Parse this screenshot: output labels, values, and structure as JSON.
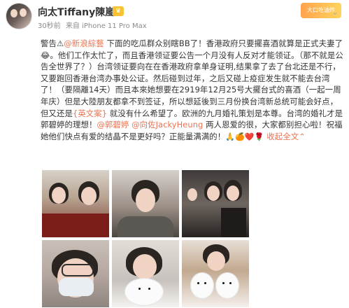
{
  "header": {
    "username": "向太Tiffany陳嵐",
    "vip_badge": "♛",
    "time": "30秒前",
    "device": "来自 iPhone 11 Pro Max",
    "chevron": "⌄",
    "top_right_badge": "大口吃油炸"
  },
  "post": {
    "p1": "警告⚠",
    "mention1": "@新浪綜藝",
    "p2": " 下面的吃瓜群众别瞎BB了！香港政府只要擺喜酒就算是正式夫妻了😂。他们工作太忙了，而且香港领证要公告一个月没有人反对才能领证。（那不就是公告全世界了？）台湾领证要向在在香港政府拿单身证明,结果拿了去了台北还是不行，又要跑回香港台湾办事处公证。然后碰到过年，之后又碰上疫症发生就不能去台湾了！（要隔離14天）而且本來她想要在2919年12月25号大擺台式的喜酒（一起一周年庆）但是大陸朋友都拿不到签证，所以想延後到三月份换台湾新总统可能会好点，但又还是",
    "english": "{英文案}",
    "p3": " 就没有什么希望了。欧洲的九月婚礼策划是本尊。台湾的婚礼才是郭碧婷的理想！",
    "mention2": "@郭碧婷",
    "mention3": "@向佐JackyHeung",
    "p4": " 两人恩爱的很，大家都别担心啦！祝福她他们快点有爱的结晶不是更好吗？正能量满满的！",
    "emojis": "🙏🍊❤️🌹",
    "collapse": "收起全文",
    "collapse_icon": "⌃"
  },
  "photos": [
    {
      "name": "photo-couple-selfie"
    },
    {
      "name": "photo-man-portrait"
    },
    {
      "name": "photo-group-dark"
    },
    {
      "name": "photo-masked-woman"
    },
    {
      "name": "photo-woman-with-dog"
    },
    {
      "name": "photo-man-with-dogs"
    }
  ]
}
